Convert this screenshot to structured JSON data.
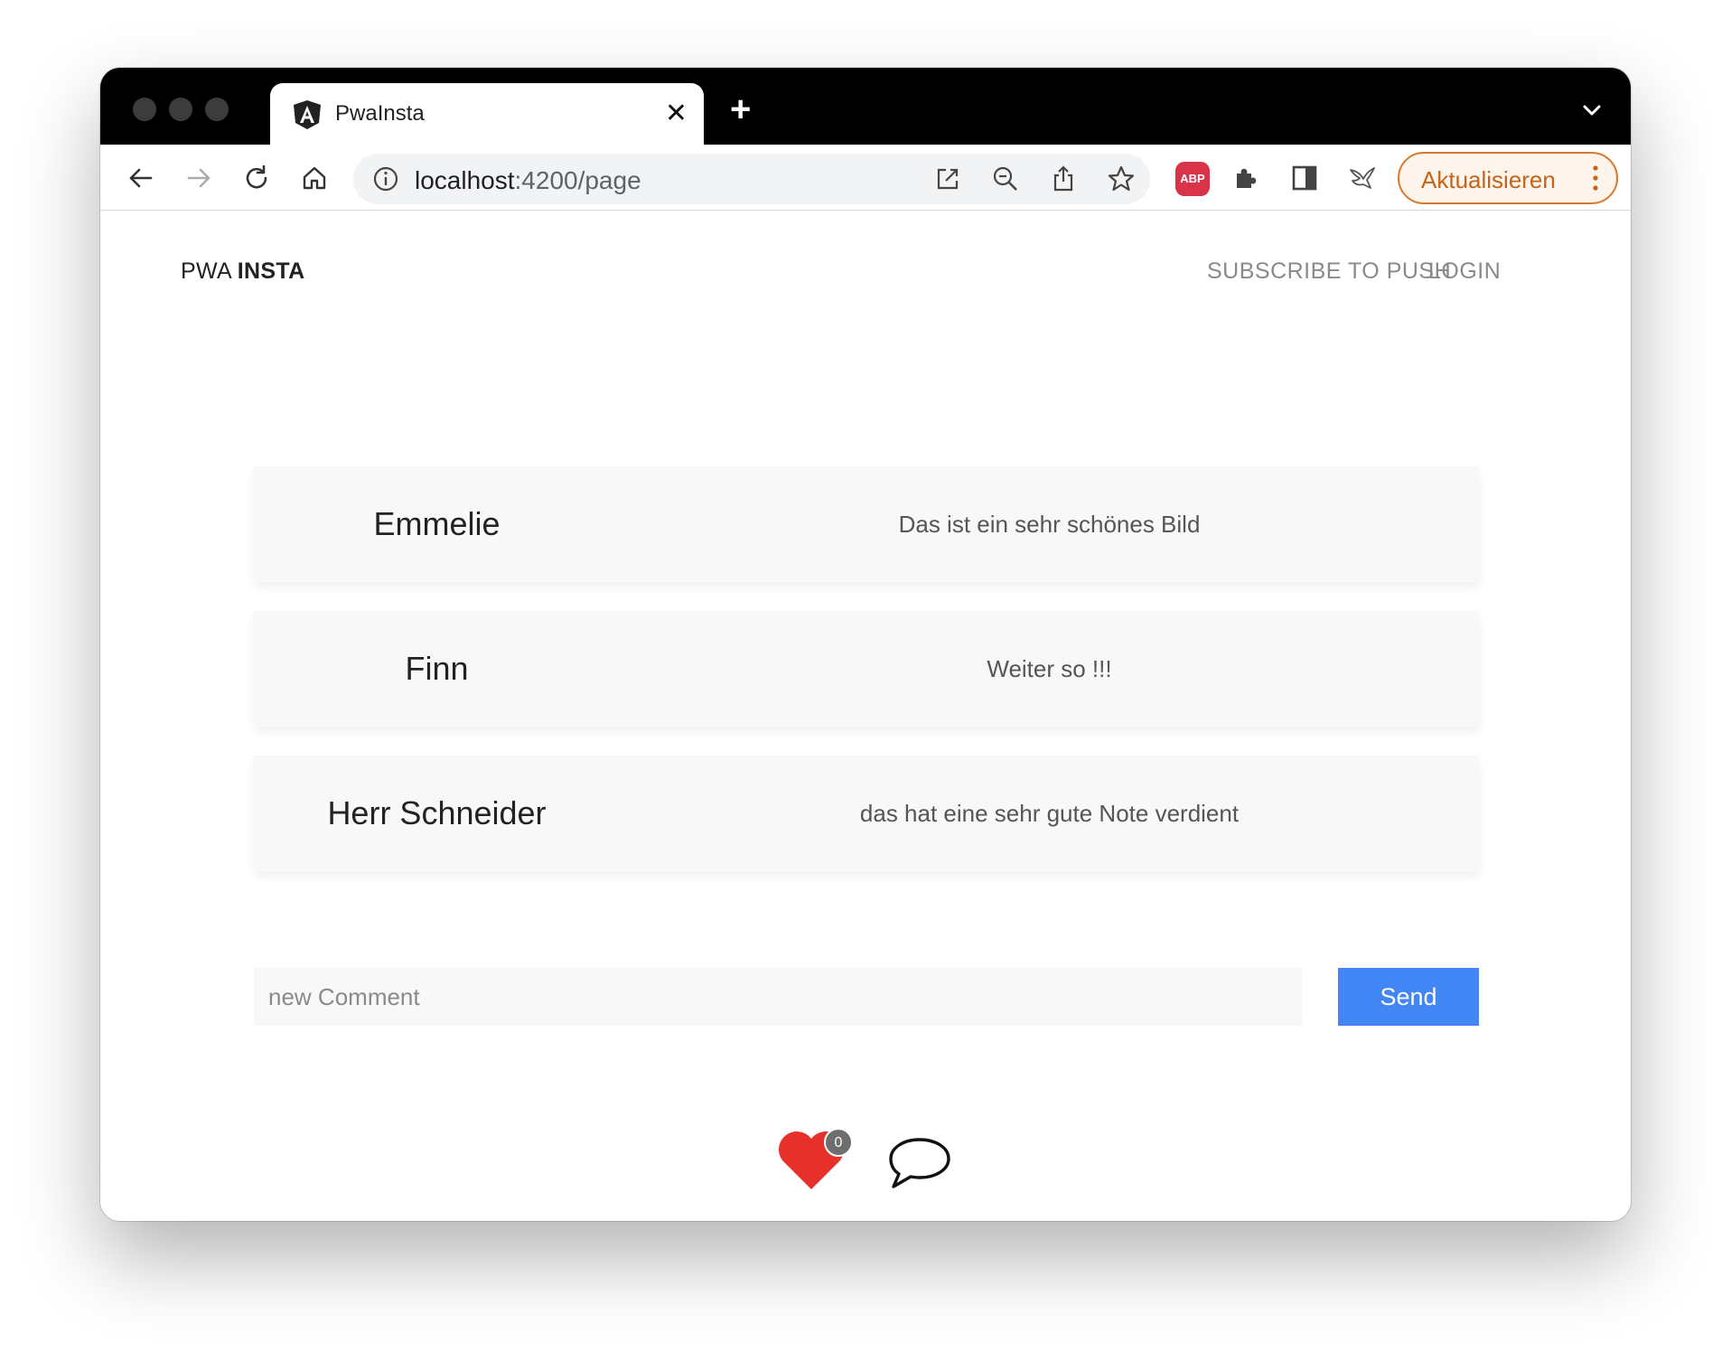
{
  "browser": {
    "tab_title": "PwaInsta",
    "new_tab_label": "+",
    "url_host": "localhost",
    "url_rest": ":4200/page",
    "abp_label": "ABP",
    "update_button_label": "Aktualisieren"
  },
  "app": {
    "brand_prefix": "PWA ",
    "brand_bold": "INSTA",
    "nav": {
      "subscribe_label": "SUBSCRIBE TO PUSH",
      "login_label": "LOGIN"
    },
    "comments": [
      {
        "author": "Emmelie",
        "text": "Das ist ein sehr schönes Bild"
      },
      {
        "author": "Finn",
        "text": "Weiter so !!!"
      },
      {
        "author": "Herr Schneider",
        "text": "das hat eine sehr gute Note verdient"
      }
    ],
    "comment_input": {
      "placeholder": "new Comment",
      "value": ""
    },
    "send_label": "Send",
    "like_count": "0"
  },
  "colors": {
    "accent": "#4285f4",
    "heart": "#e8302a",
    "update_accent": "#d9772b"
  }
}
